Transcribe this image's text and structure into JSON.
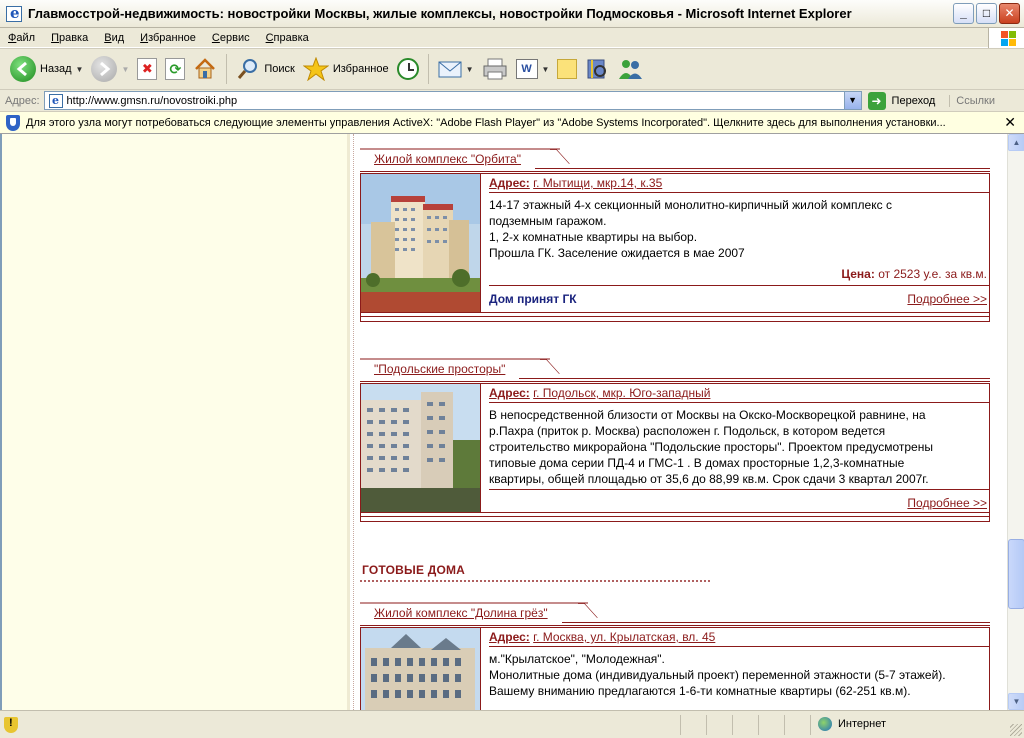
{
  "window": {
    "title": "Главмосстрой-недвижимость: новостройки Москвы, жилые комплексы, новостройки Подмосковья - Microsoft Internet Explorer",
    "minimize": "_",
    "maximize": "□",
    "close": "✕"
  },
  "menu": [
    "Файл",
    "Правка",
    "Вид",
    "Избранное",
    "Сервис",
    "Справка"
  ],
  "toolbar": {
    "back": "Назад",
    "search": "Поиск",
    "favorites": "Избранное"
  },
  "address": {
    "label": "Адрес:",
    "url": "http://www.gmsn.ru/novostroiki.php",
    "go": "Переход",
    "links": "Ссылки"
  },
  "infobar": {
    "text": "Для этого узла могут потребоваться следующие элементы управления ActiveX: \"Adobe Flash Player\" из \"Adobe Systems Incorporated\". Щелкните здесь для выполнения установки..."
  },
  "listings": [
    {
      "title": "Жилой комплекс \"Орбита\"",
      "address_label": "Адрес:",
      "address": "г. Мытищи, мкр.14, к.35",
      "description_lines": [
        "14-17 этажный 4-х секционный монолитно-кирпичный жилой комплекс с",
        "подземным гаражом.",
        "1, 2-х комнатные квартиры на выбор.",
        "Прошла ГК. Заселение ожидается в мае 2007"
      ],
      "price_label": "Цена:",
      "price": "от 2523 у.е. за кв.м.",
      "status": "Дом принят ГК",
      "more": "Подробнее >>"
    },
    {
      "title": "\"Подольские просторы\"",
      "address_label": "Адрес:",
      "address": "г. Подольск, мкр. Юго-западный",
      "description_lines": [
        "В непосредственной близости от Москвы на Окско-Москворецкой равнине, на",
        "р.Пахра (приток р. Москва) расположен г. Подольск, в котором ведется",
        "строительство микрорайона \"Подольские просторы\". Проектом предусмотрены",
        "типовые дома серии ПД-4 и ГМС-1 . В домах просторные 1,2,3-комнатные",
        "квартиры, общей площадью от 35,6 до 88,99 кв.м. Срок сдачи 3 квартал 2007г."
      ],
      "more": "Подробнее >>"
    },
    {
      "title": "Жилой комплекс \"Долина грёз\"",
      "address_label": "Адрес:",
      "address": "г. Москва, ул. Крылатская, вл. 45",
      "description_lines": [
        "м.\"Крылатское\", \"Молодежная\".",
        "Монолитные дома (индивидуальный проект) переменной этажности (5-7 этажей).",
        "Вашему вниманию предлагаются 1-6-ти комнатные квартиры (62-251 кв.м)."
      ]
    }
  ],
  "section_ready": "ГОТОВЫЕ ДОМА",
  "statusbar": {
    "zone": "Интернет"
  },
  "colors": {
    "accent": "#8B1A1A",
    "status_blue": "#1A237E",
    "left_panel": "#FEFEE9"
  }
}
